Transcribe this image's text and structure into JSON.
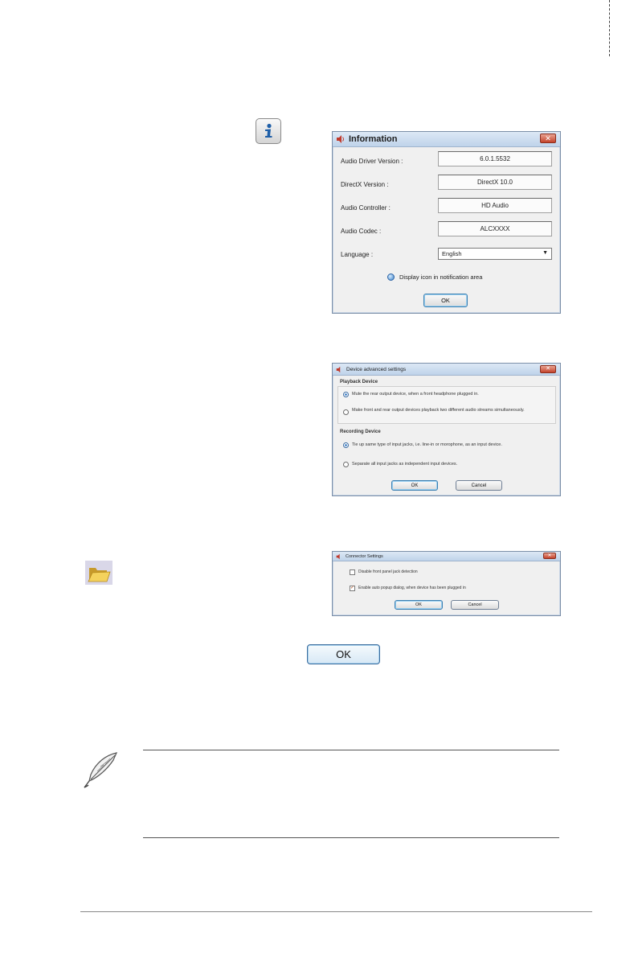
{
  "info_dialog": {
    "title": "Information",
    "rows": [
      {
        "label": "Audio Driver Version :",
        "value": "6.0.1.5532"
      },
      {
        "label": "DirectX Version :",
        "value": "DirectX 10.0"
      },
      {
        "label": "Audio Controller :",
        "value": "HD Audio"
      },
      {
        "label": "Audio Codec :",
        "value": "ALCXXXX"
      }
    ],
    "language_label": "Language :",
    "language_value": "English",
    "notification_label": "Display icon in notification area",
    "ok_label": "OK"
  },
  "advanced_dialog": {
    "title": "Device advanced settings",
    "playback_heading": "Playback Device",
    "playback_options": [
      "Mute the rear output device, when a front headphone plugged in.",
      "Make front and rear output devices playback two different audio streams simultaneously."
    ],
    "recording_heading": "Recording Device",
    "recording_options": [
      "Tie up same type of input jacks, i.e. line-in or morophone, as an input device.",
      "Separate all input jacks as independent input devices."
    ],
    "ok_label": "OK",
    "cancel_label": "Cancel"
  },
  "connector_dialog": {
    "title": "Connector Settings",
    "options": [
      "Disable front panel jack detection",
      "Enable auto popup dialog, when device has been plugged in"
    ],
    "ok_label": "OK",
    "cancel_label": "Cancel"
  },
  "big_ok_label": "OK"
}
